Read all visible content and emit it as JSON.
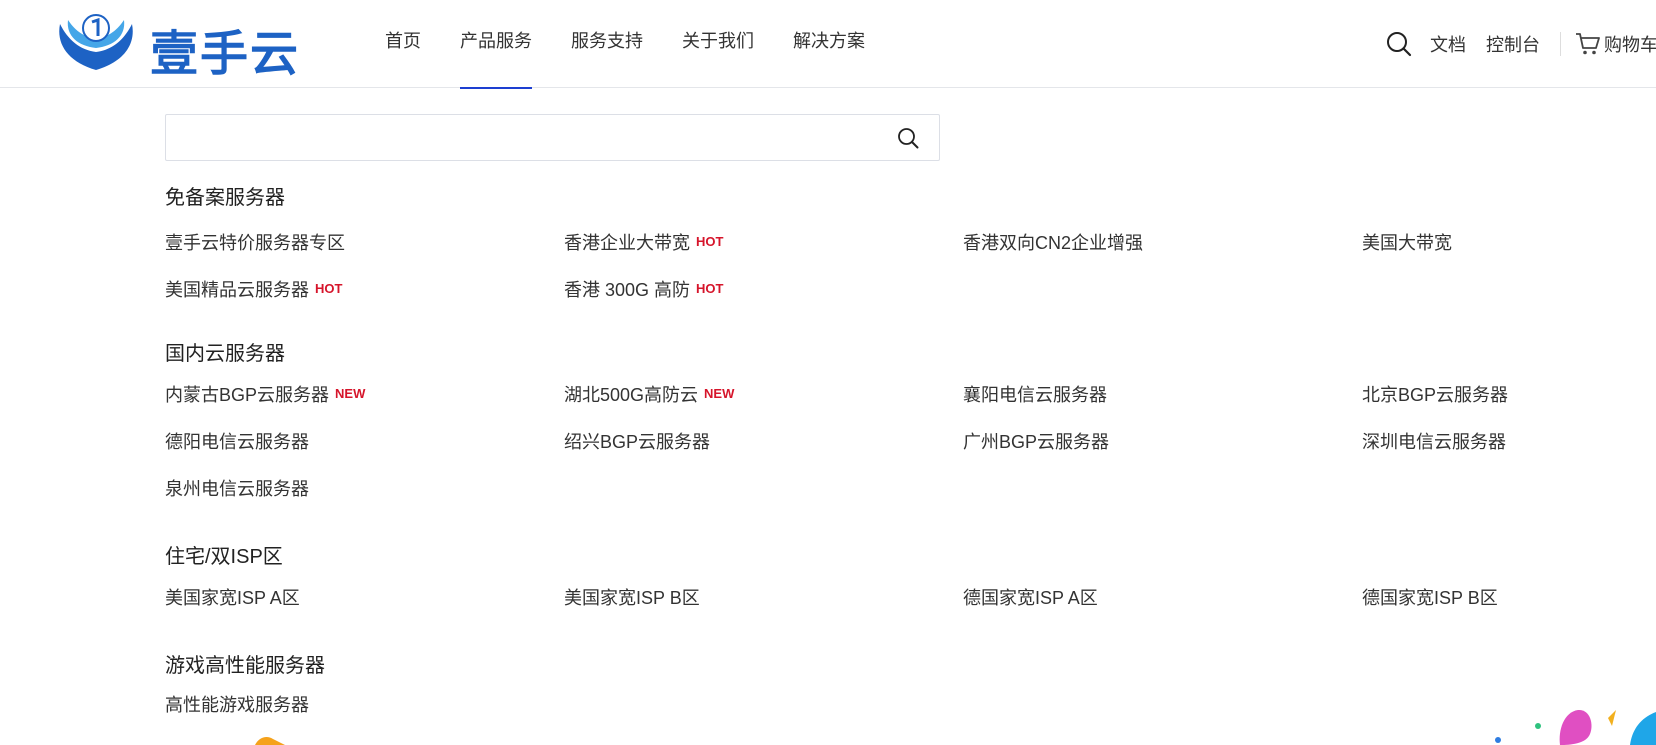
{
  "brand": {
    "name": "壹手云"
  },
  "nav": {
    "items": [
      {
        "label": "首页",
        "active": false
      },
      {
        "label": "产品服务",
        "active": true
      },
      {
        "label": "服务支持",
        "active": false
      },
      {
        "label": "关于我们",
        "active": false
      },
      {
        "label": "解决方案",
        "active": false
      }
    ]
  },
  "tools": {
    "docs": "文档",
    "console": "控制台",
    "cart": "购物车"
  },
  "search": {
    "placeholder": "",
    "value": ""
  },
  "colors": {
    "accent": "#1d3fd1",
    "brand": "#1d62c4",
    "badge": "#d6152b"
  },
  "sections": [
    {
      "title": "免备案服务器",
      "items": [
        {
          "label": "壹手云特价服务器专区",
          "badge": ""
        },
        {
          "label": "香港企业大带宽",
          "badge": "HOT"
        },
        {
          "label": "香港双向CN2企业增强",
          "badge": ""
        },
        {
          "label": "美国大带宽",
          "badge": ""
        },
        {
          "label": "美国精品云服务器",
          "badge": "HOT"
        },
        {
          "label": "香港 300G 高防",
          "badge": "HOT"
        }
      ]
    },
    {
      "title": "国内云服务器",
      "items": [
        {
          "label": "内蒙古BGP云服务器",
          "badge": "NEW"
        },
        {
          "label": "湖北500G高防云",
          "badge": "NEW"
        },
        {
          "label": "襄阳电信云服务器",
          "badge": ""
        },
        {
          "label": "北京BGP云服务器",
          "badge": ""
        },
        {
          "label": "德阳电信云服务器",
          "badge": ""
        },
        {
          "label": "绍兴BGP云服务器",
          "badge": ""
        },
        {
          "label": "广州BGP云服务器",
          "badge": ""
        },
        {
          "label": "深圳电信云服务器",
          "badge": ""
        },
        {
          "label": "泉州电信云服务器",
          "badge": ""
        }
      ]
    },
    {
      "title": "住宅/双ISP区",
      "items": [
        {
          "label": "美国家宽ISP A区",
          "badge": ""
        },
        {
          "label": "美国家宽ISP B区",
          "badge": ""
        },
        {
          "label": "德国家宽ISP A区",
          "badge": ""
        },
        {
          "label": "德国家宽ISP B区",
          "badge": ""
        }
      ]
    },
    {
      "title": "游戏高性能服务器",
      "items": [
        {
          "label": "高性能游戏服务器",
          "badge": ""
        }
      ]
    }
  ]
}
